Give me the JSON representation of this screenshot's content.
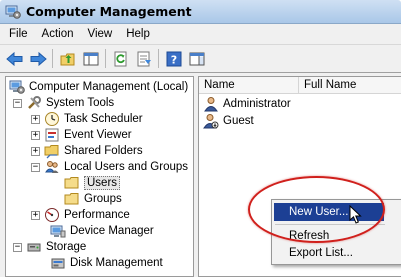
{
  "window": {
    "title": "Computer Management",
    "icon": "computer-management-icon"
  },
  "menu": [
    "File",
    "Action",
    "View",
    "Help"
  ],
  "toolbar": {
    "buttons": [
      "back-arrow-icon",
      "forward-arrow-icon",
      "up-folder-icon",
      "show-hide-tree-icon",
      "refresh-icon",
      "export-list-icon",
      "help-icon",
      "properties-pane-icon"
    ]
  },
  "tree": {
    "root": "Computer Management (Local)",
    "system_tools": "System Tools",
    "task_scheduler": "Task Scheduler",
    "event_viewer": "Event Viewer",
    "shared_folders": "Shared Folders",
    "local_users_groups": "Local Users and Groups",
    "users": "Users",
    "groups": "Groups",
    "performance": "Performance",
    "device_manager": "Device Manager",
    "storage": "Storage",
    "disk_management": "Disk Management"
  },
  "list": {
    "columns": [
      "Name",
      "Full Name"
    ],
    "rows": [
      "Administrator",
      "Guest"
    ]
  },
  "context_menu": {
    "items": [
      "New User...",
      "Refresh",
      "Export List..."
    ],
    "highlighted": "New User..."
  },
  "colors": {
    "highlight": "#1c3f94",
    "annotation": "#d0201c",
    "titlebar": "#b8d1ec"
  }
}
